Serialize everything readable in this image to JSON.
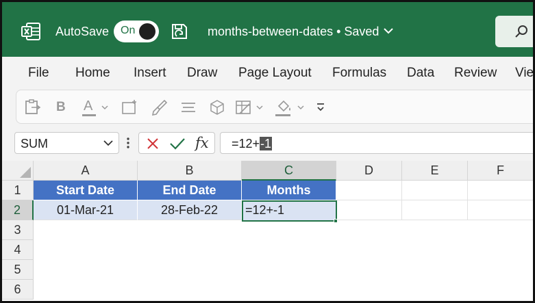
{
  "title_bar": {
    "app_icon": "excel-logo-icon",
    "autosave_label": "AutoSave",
    "autosave_state": "On",
    "filename": "months-between-dates • Saved",
    "accent": "#217346"
  },
  "menu": {
    "items": [
      "File",
      "Home",
      "Insert",
      "Draw",
      "Page Layout",
      "Formulas",
      "Data",
      "Review",
      "Vie"
    ]
  },
  "ribbon": {
    "icons": [
      "paste-icon",
      "bold-icon",
      "font-color-icon",
      "borders-icon",
      "format-painter-icon",
      "align-icon",
      "cube-icon",
      "table-format-icon",
      "fill-color-icon",
      "more-icon"
    ],
    "bold_label": "B",
    "font_color_label": "A"
  },
  "formula_bar": {
    "name_box": "SUM",
    "fx_label": "fx",
    "formula_prefix": "=12+",
    "formula_selected": "-1"
  },
  "grid": {
    "columns": [
      "A",
      "B",
      "C",
      "D",
      "E",
      "F"
    ],
    "rows": [
      "1",
      "2",
      "3",
      "4",
      "5",
      "6"
    ],
    "header_row": [
      "Start Date",
      "End Date",
      "Months"
    ],
    "data_row": [
      "01-Mar-21",
      "28-Feb-22",
      "=12+-1"
    ],
    "active_cell": "C2",
    "header_fill": "#4472c4",
    "data_fill": "#dae3f3"
  }
}
